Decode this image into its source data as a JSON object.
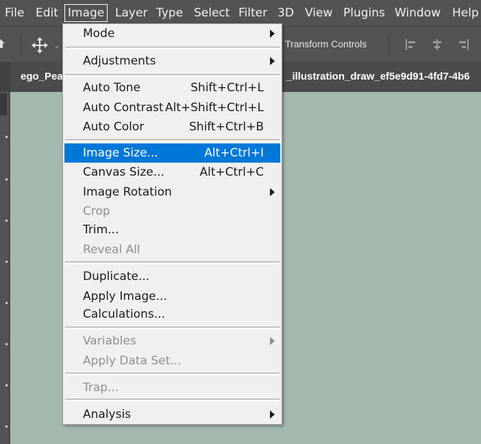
{
  "menubar": {
    "items": [
      "File",
      "Edit",
      "Image",
      "Layer",
      "Type",
      "Select",
      "Filter",
      "3D",
      "View",
      "Plugins",
      "Window",
      "Help"
    ]
  },
  "options_bar": {
    "transform_label": "Transform Controls"
  },
  "tabs": {
    "left": "ego_Pea",
    "right": "_illustration_draw_ef5e9d91-4fd7-4b6"
  },
  "image_menu": {
    "mode": {
      "label": "Mode"
    },
    "adjustments": {
      "label": "Adjustments"
    },
    "auto_tone": {
      "label": "Auto Tone",
      "shortcut": "Shift+Ctrl+L"
    },
    "auto_contrast": {
      "label": "Auto Contrast",
      "shortcut": "Alt+Shift+Ctrl+L"
    },
    "auto_color": {
      "label": "Auto Color",
      "shortcut": "Shift+Ctrl+B"
    },
    "image_size": {
      "label": "Image Size...",
      "shortcut": "Alt+Ctrl+I"
    },
    "canvas_size": {
      "label": "Canvas Size...",
      "shortcut": "Alt+Ctrl+C"
    },
    "image_rotation": {
      "label": "Image Rotation"
    },
    "crop": {
      "label": "Crop"
    },
    "trim": {
      "label": "Trim..."
    },
    "reveal_all": {
      "label": "Reveal All"
    },
    "duplicate": {
      "label": "Duplicate..."
    },
    "apply_image": {
      "label": "Apply Image..."
    },
    "calculations": {
      "label": "Calculations..."
    },
    "variables": {
      "label": "Variables"
    },
    "apply_data_set": {
      "label": "Apply Data Set..."
    },
    "trap": {
      "label": "Trap..."
    },
    "analysis": {
      "label": "Analysis"
    }
  },
  "colors": {
    "highlight": "#0078d7",
    "canvas": "#a3b9ae",
    "chrome": "#535353"
  }
}
